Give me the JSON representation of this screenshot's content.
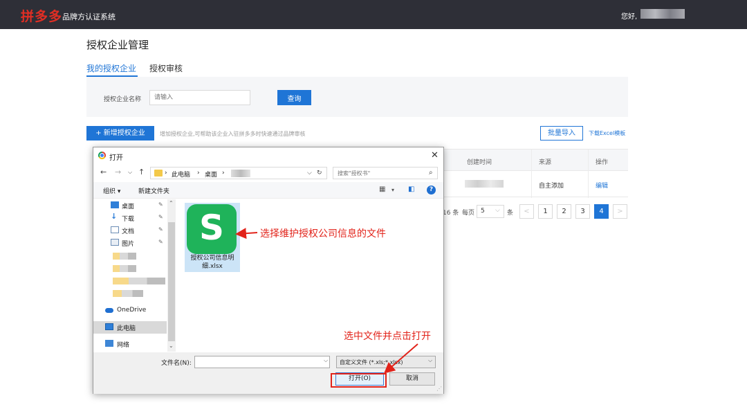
{
  "header": {
    "logo_text": "拼多多",
    "system_name": "品牌方认证系统",
    "greeting": "您好,"
  },
  "page": {
    "title": "授权企业管理",
    "tabs": [
      {
        "label": "我的授权企业",
        "active": true
      },
      {
        "label": "授权审核",
        "active": false
      }
    ],
    "filter": {
      "label": "授权企业名称",
      "placeholder": "请输入",
      "query_button": "查询"
    },
    "actions": {
      "add_button": "+ 新增授权企业",
      "add_hint": "增加授权企业,可帮助该企业入驻拼多多时快速通过品牌审核",
      "import_button": "批量导入",
      "download_template": "下载Excel模板"
    },
    "table": {
      "headers": [
        "创建时间",
        "来源",
        "操作"
      ],
      "rows": [
        {
          "source": "自主添加",
          "action": "编辑"
        }
      ]
    },
    "pagination": {
      "total_suffix": "16 条",
      "per_page_label": "每页",
      "per_page_value": "5",
      "per_page_unit": "条",
      "prev": "<",
      "next": ">",
      "pages": [
        "1",
        "2",
        "3",
        "4"
      ],
      "current": "4"
    }
  },
  "dialog": {
    "title": "打开",
    "close": "✕",
    "breadcrumb": [
      "此电脑",
      "桌面"
    ],
    "search_placeholder": "搜索\"授权书\"",
    "toolbar": {
      "organize": "组织 ▾",
      "new_folder": "新建文件夹"
    },
    "nav_items": [
      {
        "label": "桌面",
        "pinned": true
      },
      {
        "label": "下载",
        "pinned": true
      },
      {
        "label": "文档",
        "pinned": true
      },
      {
        "label": "图片",
        "pinned": true
      },
      {
        "label": "OneDrive",
        "pinned": false
      },
      {
        "label": "此电脑",
        "pinned": false,
        "selected": true
      },
      {
        "label": "网络",
        "pinned": false
      }
    ],
    "file": {
      "icon_letter": "S",
      "name": "授权公司信息明细.xlsx"
    },
    "filename_label": "文件名(N):",
    "filetype": "自定义文件 (*.xls;*.xlsx)",
    "open_button": "打开(O)",
    "cancel_button": "取消"
  },
  "annotations": {
    "select_file": "选择维护授权公司信息的文件",
    "click_open": "选中文件并点击打开"
  },
  "colors": {
    "header_bg": "#2e2f37",
    "brand_red": "#e02e24",
    "primary_blue": "#1f75d6",
    "annotation_red": "#e2231a",
    "wps_green": "#1fb35a"
  }
}
